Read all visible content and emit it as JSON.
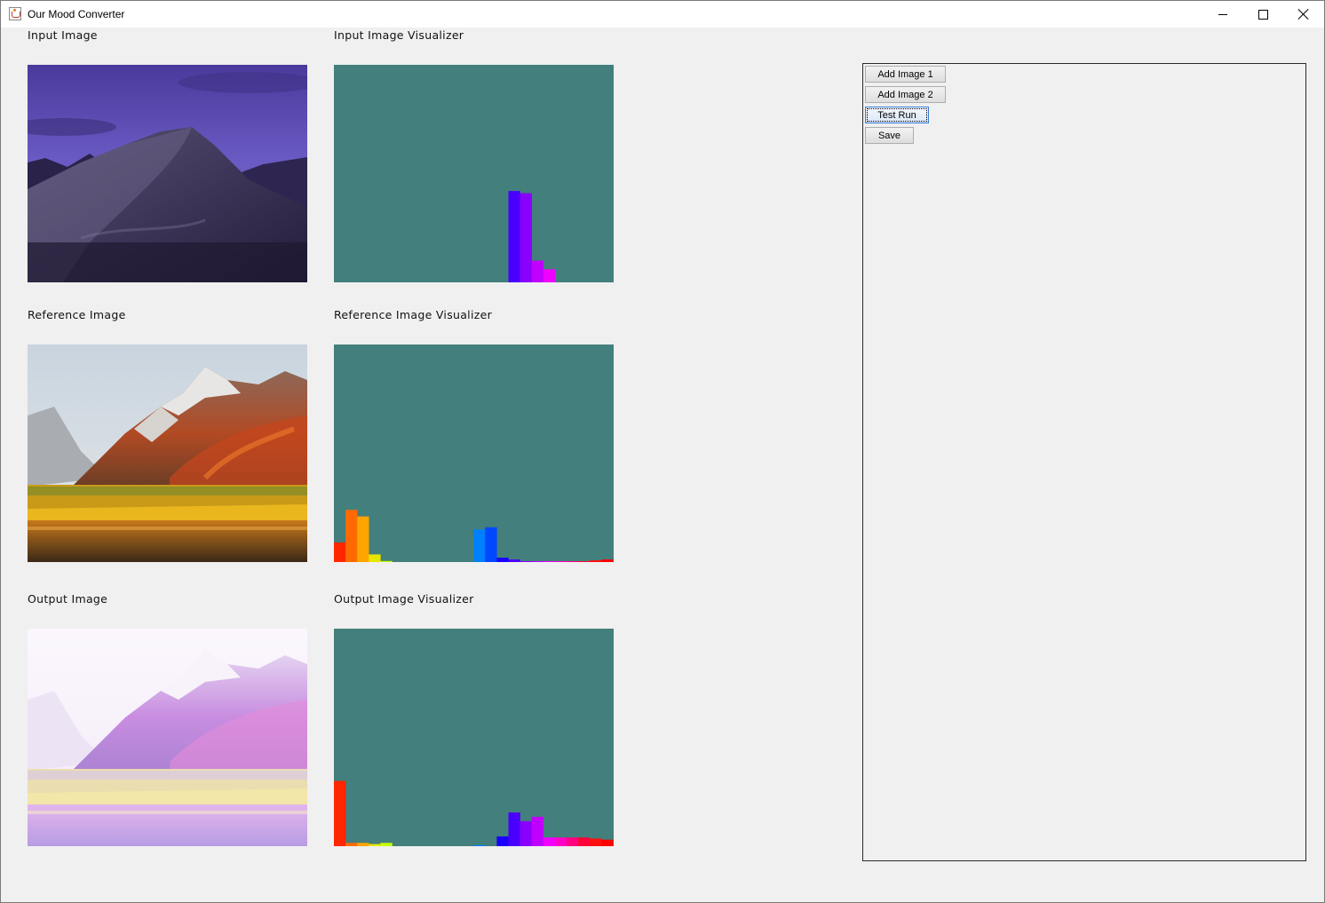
{
  "window": {
    "title": "Our Mood Converter"
  },
  "sections": {
    "input_label": "Input Image",
    "input_viz_label": "Input Image Visualizer",
    "reference_label": "Reference Image",
    "reference_viz_label": "Reference Image Visualizer",
    "output_label": "Output Image",
    "output_viz_label": "Output Image Visualizer"
  },
  "buttons": {
    "add_image_1": "Add Image 1",
    "add_image_2": "Add Image 2",
    "test_run": "Test Run",
    "save": "Save"
  },
  "colors": {
    "visualizer_bg": "#437f7c",
    "panel_bg": "#f0f0f0"
  },
  "histograms": {
    "bin_colors": [
      "#ff2600",
      "#ff6a00",
      "#ffa500",
      "#e8e600",
      "#c8ff00",
      "#7dff00",
      "#2eff00",
      "#00ff3a",
      "#00ff88",
      "#00ffd0",
      "#00e5ff",
      "#00b0ff",
      "#0080ff",
      "#0048ff",
      "#1a00ff",
      "#4a00ff",
      "#8a00ff",
      "#c000ff",
      "#f000ff",
      "#ff00c8",
      "#ff0080",
      "#ff0038",
      "#ff1010",
      "#ff0000"
    ],
    "input": [
      0,
      0,
      0,
      0,
      0,
      0,
      0,
      0,
      0,
      0,
      0,
      0,
      0,
      0,
      0,
      0.42,
      0.41,
      0.1,
      0.06,
      0,
      0,
      0,
      0,
      0
    ],
    "reference": [
      0.09,
      0.24,
      0.21,
      0.035,
      0.005,
      0,
      0,
      0,
      0,
      0,
      0,
      0,
      0.15,
      0.16,
      0.02,
      0.012,
      0.004,
      0.004,
      0.004,
      0.004,
      0.004,
      0.004,
      0.008,
      0.012
    ],
    "output": [
      0.3,
      0.015,
      0.015,
      0.01,
      0.015,
      0,
      0,
      0,
      0,
      0,
      0,
      0,
      0.005,
      0,
      0.045,
      0.155,
      0.115,
      0.135,
      0.04,
      0.04,
      0.04,
      0.04,
      0.035,
      0.03
    ]
  }
}
